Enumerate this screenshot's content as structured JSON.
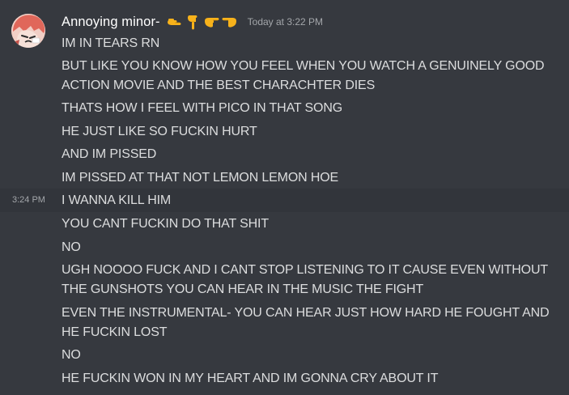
{
  "message": {
    "username": "Annoying minor-",
    "emojis": [
      "pointing-right-hand-emoji",
      "pointing-down-hand-emoji",
      "pointing-right-hand-emoji",
      "pointing-left-hand-emoji"
    ],
    "timestamp": "Today at 3:22 PM",
    "hover_time": "3:24 PM",
    "lines": [
      "IM IN TEARS RN",
      "BUT LIKE YOU KNOW HOW YOU FEEL WHEN YOU WATCH A GENUINELY GOOD ACTION MOVIE AND THE BEST CHARACHTER DIES",
      "THATS HOW I FEEL WITH PICO IN THAT SONG",
      "HE JUST LIKE SO FUCKIN HURT",
      "AND IM PISSED",
      "IM PISSED AT THAT NOT LEMON LEMON HOE",
      "I WANNA KILL HIM",
      "YOU CANT FUCKIN DO THAT SHIT",
      "NO",
      "UGH NOOOO FUCK AND I CANT STOP LISTENING TO IT CAUSE EVEN WITHOUT THE GUNSHOTS YOU CAN HEAR IN THE MUSIC THE FIGHT",
      "EVEN THE INSTRUMENTAL- YOU CAN HEAR JUST HOW HARD HE FOUGHT AND HE FUCKIN LOST",
      "NO",
      "HE FUCKIN WON IN MY HEART AND IM GONNA CRY ABOUT IT"
    ]
  },
  "colors": {
    "background": "#36393f",
    "hover_row": "#32353b",
    "username": "#ffffff",
    "text": "#dcddde",
    "muted": "#a3a6aa"
  }
}
